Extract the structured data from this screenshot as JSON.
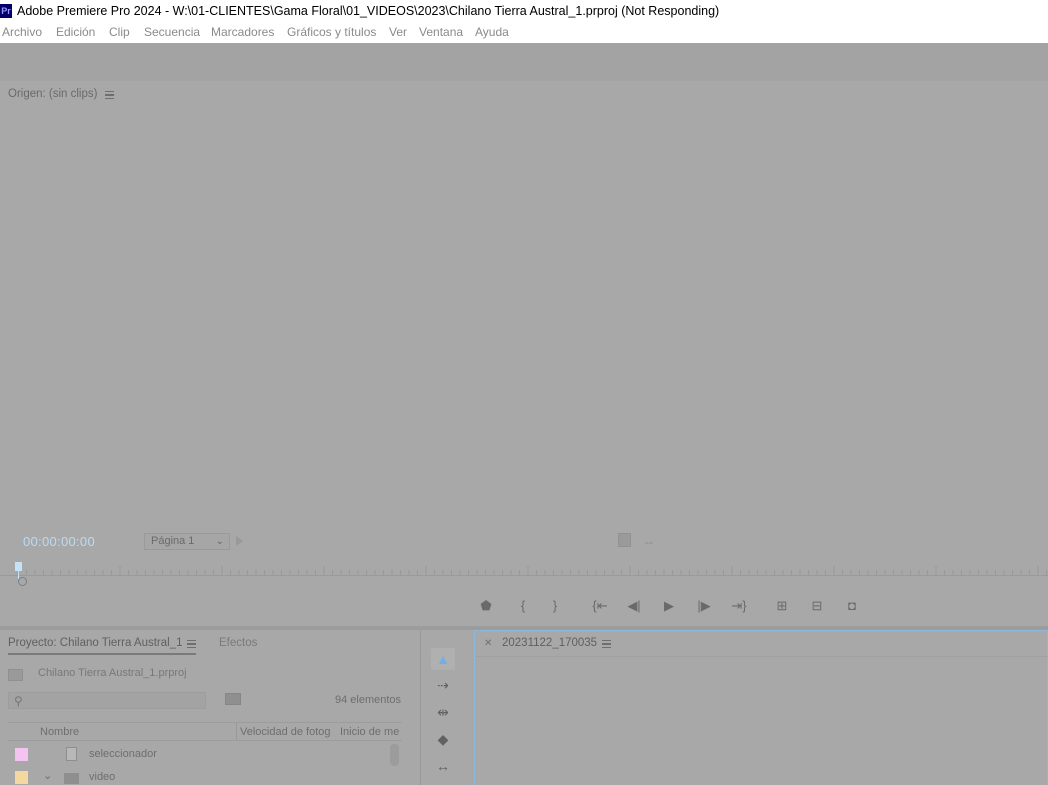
{
  "titlebar": {
    "logo": "Pr",
    "title": "Adobe Premiere Pro 2024 - W:\\01-CLIENTES\\Gama Floral\\01_VIDEOS\\2023\\Chilano Tierra Austral_1.prproj (Not Responding)"
  },
  "menu": {
    "items": [
      "Archivo",
      "Edición",
      "Clip",
      "Secuencia",
      "Marcadores",
      "Gráficos y títulos",
      "Ver",
      "Ventana",
      "Ayuda"
    ]
  },
  "source_monitor": {
    "title": "Origen: (sin clips)",
    "timecode": "00:00:00:00",
    "page_select": "Página 1",
    "transport_icons": [
      "marker-icon",
      "mark-in-icon",
      "mark-out-icon",
      "go-to-in-icon",
      "step-back-icon",
      "play-icon",
      "step-forward-icon",
      "go-to-out-icon",
      "insert-icon",
      "overwrite-icon",
      "export-frame-icon"
    ]
  },
  "project_panel": {
    "tab_project": "Proyecto: Chilano Tierra Austral_1",
    "tab_effects": "Efectos",
    "project_file": "Chilano Tierra Austral_1.prproj",
    "search_placeholder": "",
    "item_count": "94 elementos",
    "columns": [
      "Nombre",
      "Velocidad de fotog",
      "Inicio de me"
    ],
    "rows": [
      {
        "label": "seleccionador",
        "color": "#f4c4f0",
        "type": "sequence"
      },
      {
        "label": "video",
        "color": "#f5d7a0",
        "type": "folder"
      }
    ]
  },
  "tools": [
    "selection-tool-icon",
    "track-select-tool-icon",
    "ripple-edit-tool-icon",
    "razor-tool-icon",
    "slip-tool-icon"
  ],
  "timeline": {
    "sequence_name": "20231122_170035"
  },
  "colors": {
    "timecode": "#b7dcf5",
    "accent": "#6fb0ea",
    "timeline_border": "#8db8de"
  }
}
